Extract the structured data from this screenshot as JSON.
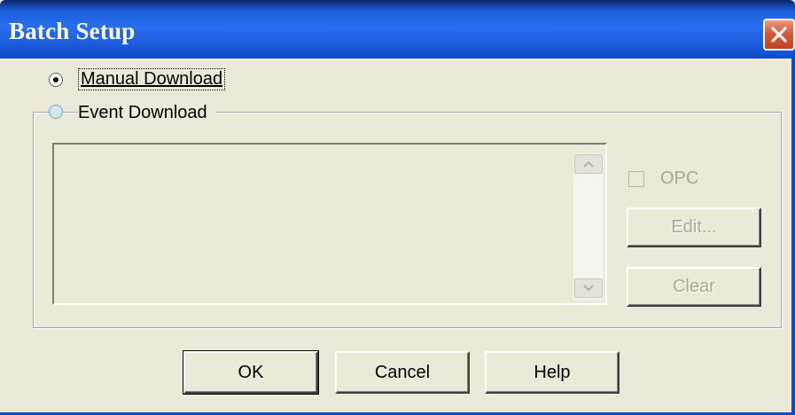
{
  "window": {
    "title": "Batch Setup",
    "close_icon": "close-icon"
  },
  "download_mode": {
    "manual_label": "Manual Download",
    "event_label": "Event Download",
    "selected": "manual"
  },
  "event_panel": {
    "opc_label": "OPC",
    "opc_checked": false,
    "edit_label": "Edit...",
    "clear_label": "Clear"
  },
  "footer": {
    "ok_label": "OK",
    "cancel_label": "Cancel",
    "help_label": "Help"
  },
  "colors": {
    "title_bar": "#1f5fe0",
    "dialog_bg": "#ece9d8",
    "disabled_text": "#aca899"
  }
}
